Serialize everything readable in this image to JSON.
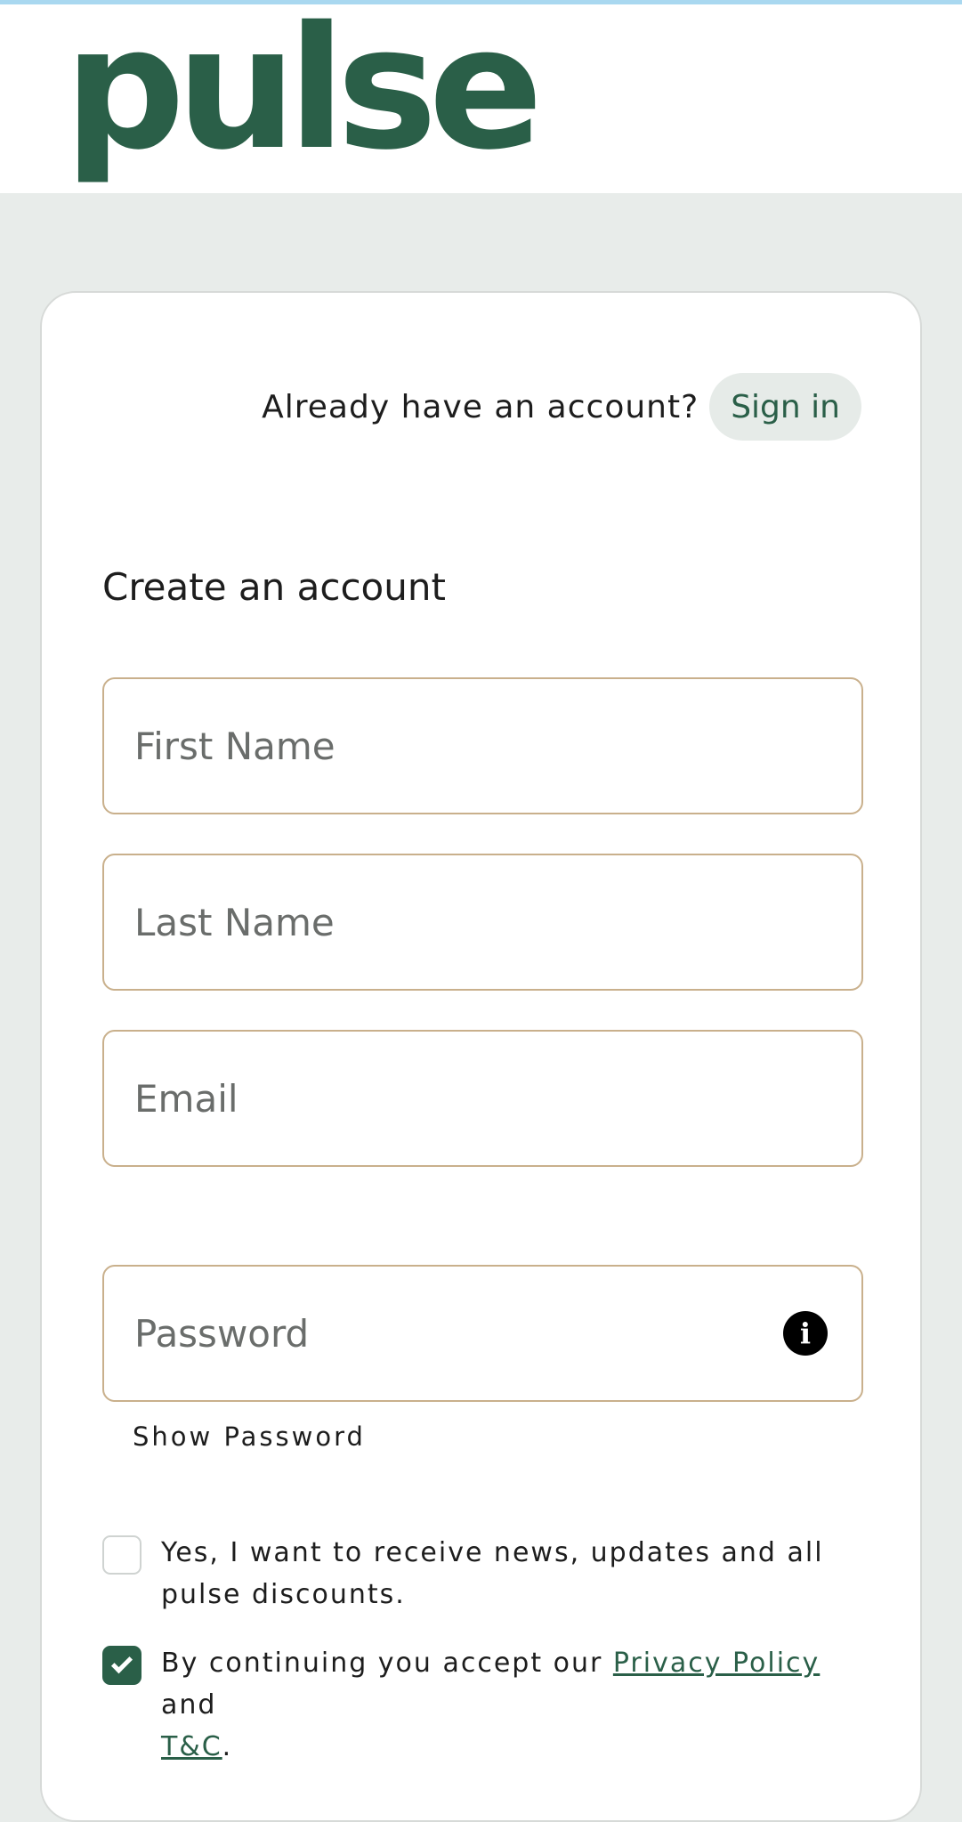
{
  "brand": {
    "logo_text": "pulse",
    "color": "#2a5f48"
  },
  "signin": {
    "prompt": "Already have an account?",
    "button_label": "Sign in"
  },
  "form": {
    "title": "Create an account",
    "first_name": {
      "placeholder": "First Name",
      "value": ""
    },
    "last_name": {
      "placeholder": "Last Name",
      "value": ""
    },
    "email": {
      "placeholder": "Email",
      "value": ""
    },
    "password": {
      "placeholder": "Password",
      "value": "",
      "info_icon": "info-icon"
    },
    "show_password_label": "Show Password"
  },
  "consents": {
    "newsletter": {
      "checked": false,
      "text": "Yes, I want to receive news, updates and all pulse discounts."
    },
    "terms": {
      "checked": true,
      "prefix": "By continuing you accept our ",
      "privacy_link": "Privacy Policy",
      "middle": " and ",
      "tc_link": "T&C",
      "suffix": "."
    }
  }
}
